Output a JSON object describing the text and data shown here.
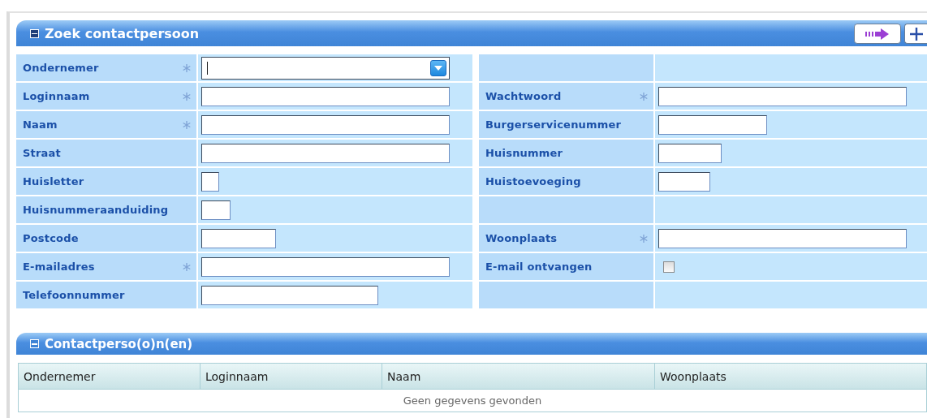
{
  "search_panel": {
    "title": "Zoek contactpersoon",
    "left_fields": [
      {
        "label": "Ondernemer",
        "required": true,
        "kind": "combo"
      },
      {
        "label": "Loginnaam",
        "required": true,
        "kind": "text"
      },
      {
        "label": "Naam",
        "required": true,
        "kind": "text"
      },
      {
        "label": "Straat",
        "required": false,
        "kind": "text"
      },
      {
        "label": "Huisletter",
        "required": false,
        "kind": "text"
      },
      {
        "label": "Huisnummeraanduiding",
        "required": false,
        "kind": "text"
      },
      {
        "label": "Postcode",
        "required": false,
        "kind": "text"
      },
      {
        "label": "E-mailadres",
        "required": true,
        "kind": "text"
      },
      {
        "label": "Telefoonnummer",
        "required": false,
        "kind": "text"
      }
    ],
    "right_fields": [
      {
        "kind": "empty"
      },
      {
        "label": "Wachtwoord",
        "required": true,
        "kind": "text"
      },
      {
        "label": "Burgerservicenummer",
        "required": false,
        "kind": "text"
      },
      {
        "label": "Huisnummer",
        "required": false,
        "kind": "text"
      },
      {
        "label": "Huistoevoeging",
        "required": false,
        "kind": "text"
      },
      {
        "kind": "empty"
      },
      {
        "label": "Woonplaats",
        "required": true,
        "kind": "text"
      },
      {
        "label": "E-mail ontvangen",
        "required": false,
        "kind": "checkbox",
        "checked": false
      },
      {
        "kind": "empty"
      }
    ]
  },
  "results_panel": {
    "title": "Contactperso(o)n(en)",
    "columns": [
      "Ondernemer",
      "Loginnaam",
      "Naam",
      "Woonplaats"
    ],
    "empty_message": "Geen gegevens gevonden"
  }
}
